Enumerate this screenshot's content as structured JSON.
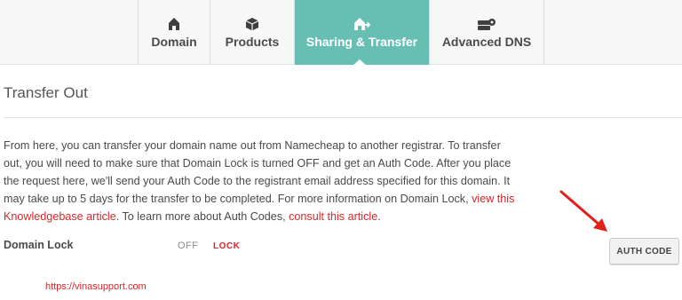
{
  "tabs": [
    {
      "label": "Domain",
      "icon": "house-icon",
      "active": false
    },
    {
      "label": "Products",
      "icon": "box-icon",
      "active": false
    },
    {
      "label": "Sharing & Transfer",
      "icon": "house-arrow-icon",
      "active": true
    },
    {
      "label": "Advanced DNS",
      "icon": "server-gear-icon",
      "active": false
    }
  ],
  "section": {
    "title": "Transfer Out"
  },
  "description": {
    "text_1": "From here, you can transfer your domain name out from Namecheap to another registrar. To transfer out, you will need to make sure that Domain Lock is turned OFF and get an Auth Code. After you place the request here, we'll send your Auth Code to the registrant email address specified for this domain. It may take up to 5 days for the transfer to be completed. For more information on Domain Lock, ",
    "link_1": "view this Knowledgebase article",
    "text_2": ". To learn more about Auth Codes, ",
    "link_2": "consult this article",
    "text_3": "."
  },
  "domain_lock": {
    "label": "Domain Lock",
    "state": "OFF",
    "action": "LOCK"
  },
  "auth_code_button": {
    "label": "AUTH CODE"
  },
  "watermark": "https://vinasupport.com",
  "colors": {
    "accent": "#67bfb4",
    "link": "#d9262b",
    "arrow": "#e0201b"
  }
}
